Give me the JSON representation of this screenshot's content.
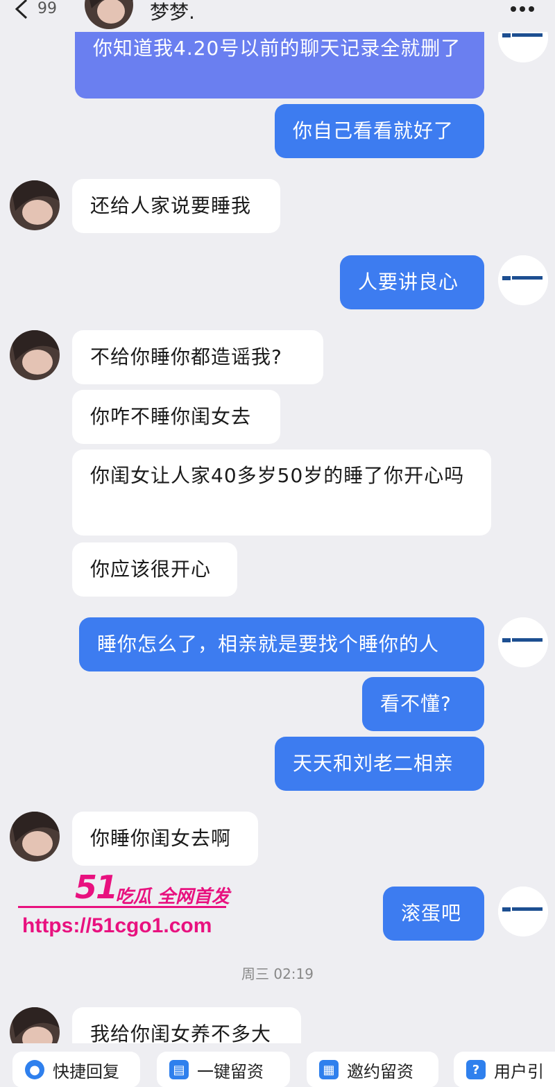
{
  "header": {
    "unread_count": "99",
    "contact_name": "梦梦."
  },
  "messages": [
    {
      "dir": "out",
      "text": "你知道我4.20号以前的聊天记录全就删了"
    },
    {
      "dir": "out",
      "text": "你自己看看就好了"
    },
    {
      "dir": "in",
      "text": "还给人家说要睡我"
    },
    {
      "dir": "out",
      "text": "人要讲良心"
    },
    {
      "dir": "in",
      "text": "不给你睡你都造谣我?"
    },
    {
      "dir": "in",
      "text": "你咋不睡你闺女去"
    },
    {
      "dir": "in",
      "text": "你闺女让人家40多岁50岁的睡了你开心吗"
    },
    {
      "dir": "in",
      "text": "你应该很开心"
    },
    {
      "dir": "out",
      "text": "睡你怎么了，相亲就是要找个睡你的人"
    },
    {
      "dir": "out",
      "text": "看不懂?"
    },
    {
      "dir": "out",
      "text": "天天和刘老二相亲"
    },
    {
      "dir": "in",
      "text": "你睡你闺女去啊"
    },
    {
      "dir": "out",
      "text": "滚蛋吧"
    },
    {
      "dir": "in",
      "text": "我给你闺女养不多大"
    }
  ],
  "timestamp": "周三 02:19",
  "watermark": {
    "number": "51",
    "tag": "吃瓜 全网首发",
    "url": "https://51cgo1.com"
  },
  "quick_replies": [
    {
      "label": "快捷回复",
      "icon": "quick-reply-icon"
    },
    {
      "label": "一键留资",
      "icon": "form-icon"
    },
    {
      "label": "邀约留资",
      "icon": "calendar-icon"
    },
    {
      "label": "用户引",
      "icon": "help-icon"
    }
  ],
  "colors": {
    "outgoing_bubble": "#3d7cf0",
    "incoming_bubble": "#ffffff",
    "background": "#eeeef2",
    "watermark": "#e8117f"
  }
}
